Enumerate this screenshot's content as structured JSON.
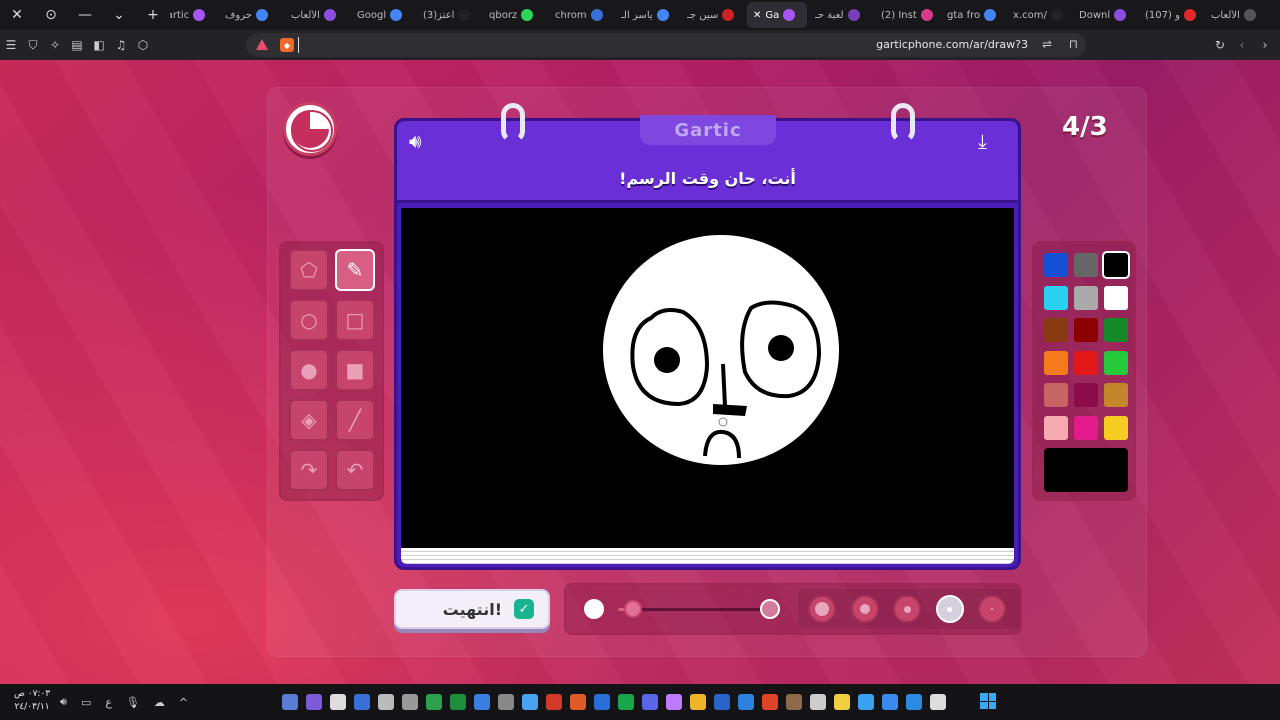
{
  "browser": {
    "tabs": [
      {
        "title": "الألعاب",
        "color": "#555"
      },
      {
        "title": "(107) و",
        "color": "#e02828"
      },
      {
        "title": "Downl",
        "color": "#8a4de0"
      },
      {
        "title": "x.com/",
        "color": "#222"
      },
      {
        "title": "gta fro",
        "color": "#4285f4"
      },
      {
        "title": "(2) Inst",
        "color": "#d63b8a"
      },
      {
        "title": "لعبة حـ",
        "color": "#7a3fb8"
      },
      {
        "title": "Ga",
        "color": "#a855f7"
      },
      {
        "title": "سين جـ",
        "color": "#c22"
      },
      {
        "title": "ياسر الـ",
        "color": "#4285f4"
      },
      {
        "title": "chrom",
        "color": "#3a6fd8"
      },
      {
        "title": "qborz",
        "color": "#2bd45a"
      },
      {
        "title": "(3)اعتز",
        "color": "#222"
      },
      {
        "title": "Googl",
        "color": "#4285f4"
      },
      {
        "title": "الألعاب",
        "color": "#8a4de0"
      },
      {
        "title": "حروف",
        "color": "#4285f4"
      },
      {
        "title": "Gartic",
        "color": "#a855f7"
      }
    ],
    "active_tab_index": 7,
    "new_tab_label": "+",
    "url": "garticphone.com/ar/draw?3"
  },
  "game": {
    "round": "4/3",
    "logo": "Gartic",
    "prompt": "أنت، حان وقت الرسم!",
    "done_label": "انتهيت!",
    "timer_remaining": 0.25,
    "brush_size_level": 0.1
  },
  "tools": [
    {
      "name": "eraser-tool",
      "glyph": "⬠",
      "selected": false
    },
    {
      "name": "pen-tool",
      "glyph": "✎",
      "selected": true
    },
    {
      "name": "ellipse-outline-tool",
      "glyph": "○",
      "selected": false
    },
    {
      "name": "rectangle-outline-tool",
      "glyph": "□",
      "selected": false
    },
    {
      "name": "ellipse-fill-tool",
      "glyph": "●",
      "selected": false
    },
    {
      "name": "rectangle-fill-tool",
      "glyph": "■",
      "selected": false
    },
    {
      "name": "fill-bucket-tool",
      "glyph": "◈",
      "selected": false
    },
    {
      "name": "line-tool",
      "glyph": "╱",
      "selected": false
    },
    {
      "name": "redo-tool",
      "glyph": "↷",
      "selected": false
    },
    {
      "name": "undo-tool",
      "glyph": "↶",
      "selected": false
    }
  ],
  "palette": [
    "#1451d4",
    "#666666",
    "#000000",
    "#2ad0f0",
    "#aaaaaa",
    "#ffffff",
    "#8a3a10",
    "#8c0000",
    "#138a2a",
    "#f47a1c",
    "#e21818",
    "#26c83c",
    "#c86464",
    "#8a0d4a",
    "#c4862a",
    "#f4aab0",
    "#e21a8c",
    "#f4cc22"
  ],
  "selected_color_index": 2,
  "brush_sizes": [
    {
      "dot": 14
    },
    {
      "dot": 10
    },
    {
      "dot": 7
    },
    {
      "dot": 5
    },
    {
      "dot": 2
    }
  ],
  "selected_brush_index": 3,
  "taskbar": {
    "time": "٠٧:٠٣ ص",
    "date": "٢٤/٠٣/١١",
    "lang": "ع"
  },
  "colors": {
    "accent": "#6a2fd6",
    "page_bg": "#b42065",
    "tool_bg": "#c7456d"
  }
}
